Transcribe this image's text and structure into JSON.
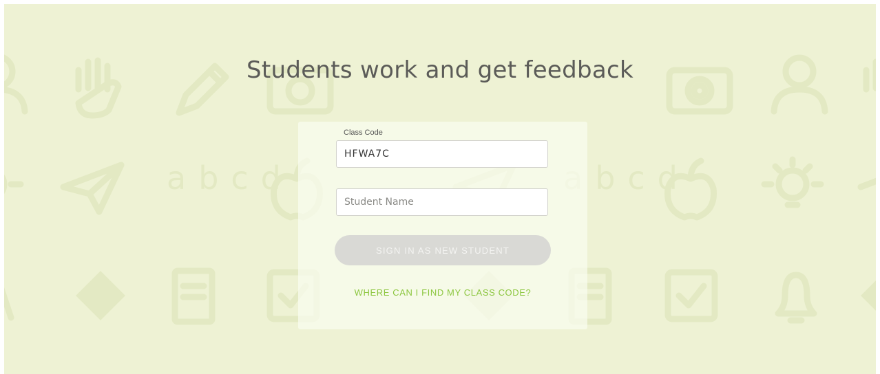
{
  "page": {
    "headline": "Students work and get feedback"
  },
  "form": {
    "class_code_label": "Class Code",
    "class_code_value": "HFWA7C",
    "student_name_value": "",
    "student_name_placeholder": "Student Name",
    "sign_in_label": "SIGN IN AS NEW STUDENT",
    "help_link_label": "WHERE CAN I FIND MY CLASS CODE?"
  },
  "background": {
    "icons": [
      "person-icon",
      "raised-hand-icon",
      "pencil-icon",
      "camera-icon",
      "lightbulb-icon",
      "paper-plane-icon",
      "abcd-letters-icon",
      "apple-icon",
      "eraser-icon",
      "document-icon",
      "checkbox-icon",
      "bell-icon"
    ],
    "abcd_text": "abcd"
  },
  "colors": {
    "background": "#eef2d4",
    "icon_tint": "#e3e9c3",
    "headline": "#5b5b58",
    "button_disabled": "#d9d9d5",
    "link": "#8cc63f"
  }
}
